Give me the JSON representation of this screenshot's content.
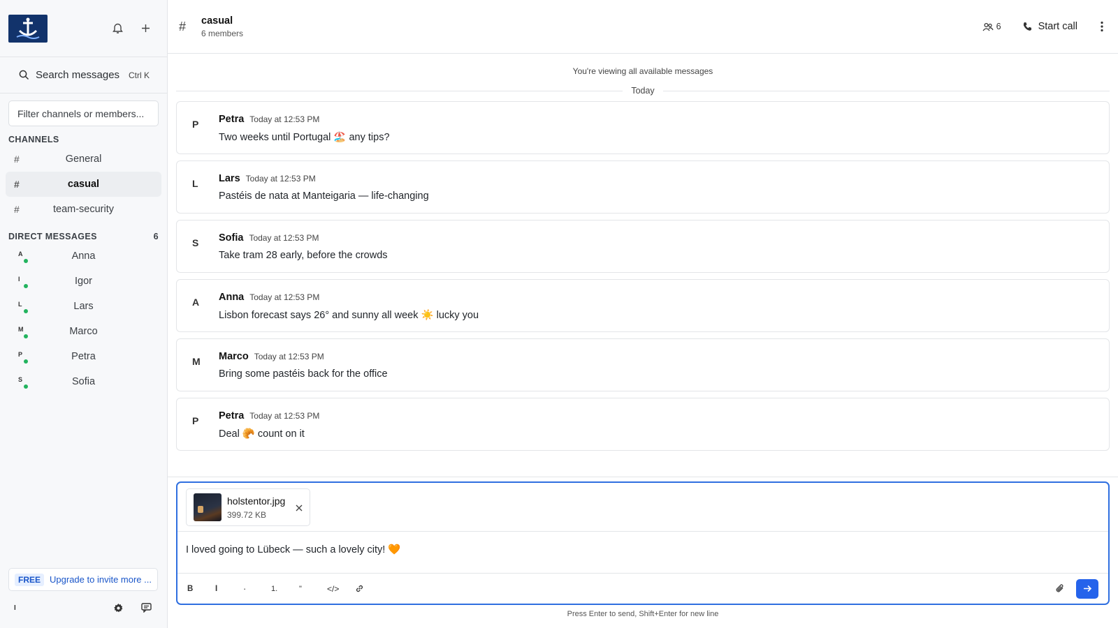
{
  "sidebar": {
    "search": {
      "label": "Search messages",
      "shortcut": "Ctrl K"
    },
    "filter_placeholder": "Filter channels or members...",
    "channels_header": "CHANNELS",
    "channels": [
      {
        "hash": "#",
        "name": "General",
        "active": false
      },
      {
        "hash": "#",
        "name": "casual",
        "active": true
      },
      {
        "hash": "#",
        "name": "team-security",
        "active": false
      }
    ],
    "dm_header": "DIRECT MESSAGES",
    "dm_count": "6",
    "dms": [
      {
        "initial": "A",
        "name": "Anna",
        "online": true
      },
      {
        "initial": "I",
        "name": "Igor",
        "online": true
      },
      {
        "initial": "L",
        "name": "Lars",
        "online": true
      },
      {
        "initial": "M",
        "name": "Marco",
        "online": true
      },
      {
        "initial": "P",
        "name": "Petra",
        "online": true
      },
      {
        "initial": "S",
        "name": "Sofia",
        "online": true
      }
    ],
    "plan_badge": "FREE",
    "upgrade_text": "Upgrade to invite more ...",
    "user_initial": "I"
  },
  "header": {
    "hash": "#",
    "channel_name": "casual",
    "members_text": "6 members",
    "member_count": "6",
    "call_label": "Start call"
  },
  "notice": "You're viewing all available messages",
  "date_divider": "Today",
  "messages": [
    {
      "initial": "P",
      "author": "Petra",
      "time": "Today at 12:53 PM",
      "text": "Two weeks until Portugal 🏖️ any tips?"
    },
    {
      "initial": "L",
      "author": "Lars",
      "time": "Today at 12:53 PM",
      "text": "Pastéis de nata at Manteigaria — life-changing"
    },
    {
      "initial": "S",
      "author": "Sofia",
      "time": "Today at 12:53 PM",
      "text": "Take tram 28 early, before the crowds"
    },
    {
      "initial": "A",
      "author": "Anna",
      "time": "Today at 12:53 PM",
      "text": "Lisbon forecast says 26° and sunny all week ☀️ lucky you"
    },
    {
      "initial": "M",
      "author": "Marco",
      "time": "Today at 12:53 PM",
      "text": "Bring some pastéis back for the office"
    },
    {
      "initial": "P",
      "author": "Petra",
      "time": "Today at 12:53 PM",
      "text": "Deal 🥐 count on it"
    }
  ],
  "composer": {
    "attachment": {
      "name": "holstentor.jpg",
      "size": "399.72 KB"
    },
    "text": "I loved going to Lübeck — such a lovely city! 🧡",
    "toolbar": {
      "bold": "B",
      "italic": "I",
      "bullet": "·",
      "numbered": "1.",
      "quote": "\"",
      "code": "</>"
    },
    "hint": "Press Enter to send, Shift+Enter for new line"
  },
  "colors": {
    "accent": "#2563eb",
    "online": "#22b35e",
    "logo_bg": "#12336b"
  }
}
